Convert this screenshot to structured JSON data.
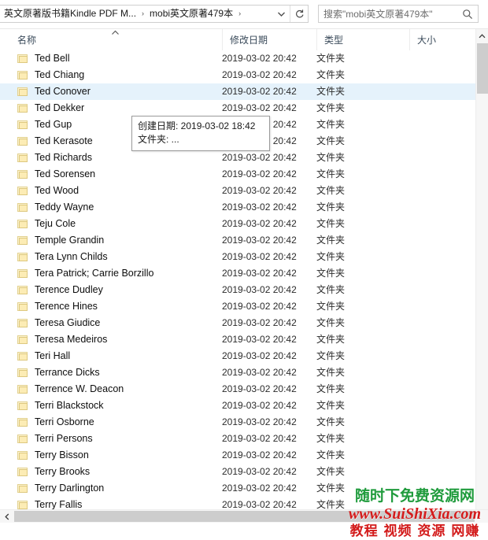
{
  "window": {
    "address": {
      "crumbs": [
        "英文原著版书籍Kindle PDF M...",
        "mobi英文原著479本"
      ],
      "separator": "›",
      "dropdown_icon": "chevron-down-icon",
      "refresh_icon": "refresh-icon"
    },
    "search": {
      "placeholder": "搜索\"mobi英文原著479本\"",
      "icon": "search-icon"
    }
  },
  "columns": [
    {
      "key": "name",
      "label": "名称",
      "sorted": "asc",
      "sort_glyph": "^"
    },
    {
      "key": "date",
      "label": "修改日期"
    },
    {
      "key": "type",
      "label": "类型"
    },
    {
      "key": "size",
      "label": "大小"
    }
  ],
  "rows": [
    {
      "name": "Ted Bell",
      "date": "2019-03-02 20:42",
      "type": "文件夹",
      "size": "",
      "selected": false
    },
    {
      "name": "Ted Chiang",
      "date": "2019-03-02 20:42",
      "type": "文件夹",
      "size": "",
      "selected": false
    },
    {
      "name": "Ted Conover",
      "date": "2019-03-02 20:42",
      "type": "文件夹",
      "size": "",
      "selected": true
    },
    {
      "name": "Ted Dekker",
      "date": "2019-03-02 20:42",
      "type": "文件夹",
      "size": "",
      "selected": false
    },
    {
      "name": "Ted Gup",
      "date": "2019-03-02 20:42",
      "type": "文件夹",
      "size": "",
      "selected": false
    },
    {
      "name": "Ted Kerasote",
      "date": "2019-03-02 20:42",
      "type": "文件夹",
      "size": "",
      "selected": false
    },
    {
      "name": "Ted Richards",
      "date": "2019-03-02 20:42",
      "type": "文件夹",
      "size": "",
      "selected": false
    },
    {
      "name": "Ted Sorensen",
      "date": "2019-03-02 20:42",
      "type": "文件夹",
      "size": "",
      "selected": false
    },
    {
      "name": "Ted Wood",
      "date": "2019-03-02 20:42",
      "type": "文件夹",
      "size": "",
      "selected": false
    },
    {
      "name": "Teddy Wayne",
      "date": "2019-03-02 20:42",
      "type": "文件夹",
      "size": "",
      "selected": false
    },
    {
      "name": "Teju Cole",
      "date": "2019-03-02 20:42",
      "type": "文件夹",
      "size": "",
      "selected": false
    },
    {
      "name": "Temple Grandin",
      "date": "2019-03-02 20:42",
      "type": "文件夹",
      "size": "",
      "selected": false
    },
    {
      "name": "Tera Lynn Childs",
      "date": "2019-03-02 20:42",
      "type": "文件夹",
      "size": "",
      "selected": false
    },
    {
      "name": "Tera Patrick; Carrie Borzillo",
      "date": "2019-03-02 20:42",
      "type": "文件夹",
      "size": "",
      "selected": false
    },
    {
      "name": "Terence Dudley",
      "date": "2019-03-02 20:42",
      "type": "文件夹",
      "size": "",
      "selected": false
    },
    {
      "name": "Terence Hines",
      "date": "2019-03-02 20:42",
      "type": "文件夹",
      "size": "",
      "selected": false
    },
    {
      "name": "Teresa Giudice",
      "date": "2019-03-02 20:42",
      "type": "文件夹",
      "size": "",
      "selected": false
    },
    {
      "name": "Teresa Medeiros",
      "date": "2019-03-02 20:42",
      "type": "文件夹",
      "size": "",
      "selected": false
    },
    {
      "name": "Teri Hall",
      "date": "2019-03-02 20:42",
      "type": "文件夹",
      "size": "",
      "selected": false
    },
    {
      "name": "Terrance Dicks",
      "date": "2019-03-02 20:42",
      "type": "文件夹",
      "size": "",
      "selected": false
    },
    {
      "name": "Terrence W. Deacon",
      "date": "2019-03-02 20:42",
      "type": "文件夹",
      "size": "",
      "selected": false
    },
    {
      "name": "Terri Blackstock",
      "date": "2019-03-02 20:42",
      "type": "文件夹",
      "size": "",
      "selected": false
    },
    {
      "name": "Terri Osborne",
      "date": "2019-03-02 20:42",
      "type": "文件夹",
      "size": "",
      "selected": false
    },
    {
      "name": "Terri Persons",
      "date": "2019-03-02 20:42",
      "type": "文件夹",
      "size": "",
      "selected": false
    },
    {
      "name": "Terry Bisson",
      "date": "2019-03-02 20:42",
      "type": "文件夹",
      "size": "",
      "selected": false
    },
    {
      "name": "Terry Brooks",
      "date": "2019-03-02 20:42",
      "type": "文件夹",
      "size": "",
      "selected": false
    },
    {
      "name": "Terry Darlington",
      "date": "2019-03-02 20:42",
      "type": "文件夹",
      "size": "",
      "selected": false
    },
    {
      "name": "Terry Fallis",
      "date": "2019-03-02 20:42",
      "type": "文件夹",
      "size": "",
      "selected": false
    }
  ],
  "tooltip": {
    "line1": "创建日期: 2019-03-02 18:42",
    "line2": "文件夹: ..."
  },
  "scrollbars": {
    "vertical_up_glyph": "^",
    "horizontal_left_glyph": "‹"
  },
  "watermark": {
    "line1": "随时下免费资源网",
    "line2": "www.SuiShiXia.com",
    "line3": "教程 视频 资源 网赚",
    "color_green": "#1f9b3c",
    "color_red": "#d31b1b"
  }
}
